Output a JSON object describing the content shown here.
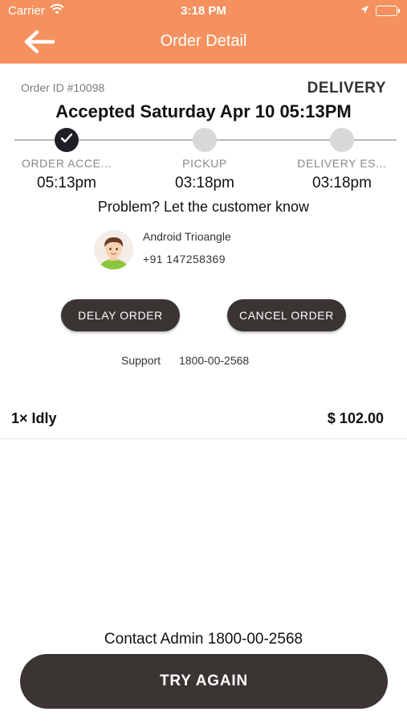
{
  "status_bar": {
    "carrier": "Carrier",
    "time": "3:18 PM"
  },
  "nav": {
    "title": "Order Detail"
  },
  "order": {
    "id_label": "Order ID #10098",
    "type": "DELIVERY",
    "accepted_title": "Accepted Saturday Apr 10 05:13PM"
  },
  "steps": [
    {
      "label": "ORDER ACCE...",
      "time": "05:13pm",
      "done": true
    },
    {
      "label": "PICKUP",
      "time": "03:18pm",
      "done": false
    },
    {
      "label": "DELIVERY ES...",
      "time": "03:18pm",
      "done": false
    }
  ],
  "problem_text": "Problem? Let the customer know",
  "customer": {
    "name": "Android Trioangle",
    "phone": "+91 147258369"
  },
  "actions": {
    "delay": "DELAY ORDER",
    "cancel": "CANCEL ORDER"
  },
  "support": {
    "label": "Support",
    "phone": "1800-00-2568"
  },
  "items": [
    {
      "name": "1× Idly",
      "price": "$ 102.00"
    }
  ],
  "contact_admin": "Contact Admin 1800-00-2568",
  "try_again": "TRY AGAIN",
  "colors": {
    "header": "#F4915E",
    "dark_button": "#3a3433",
    "step_done": "#1f1d26",
    "step_pending": "#d8d8d8"
  },
  "icons": {
    "back": "arrow-left-icon",
    "wifi": "wifi-icon",
    "location": "location-arrow-icon",
    "battery": "battery-icon",
    "check": "check-icon"
  }
}
